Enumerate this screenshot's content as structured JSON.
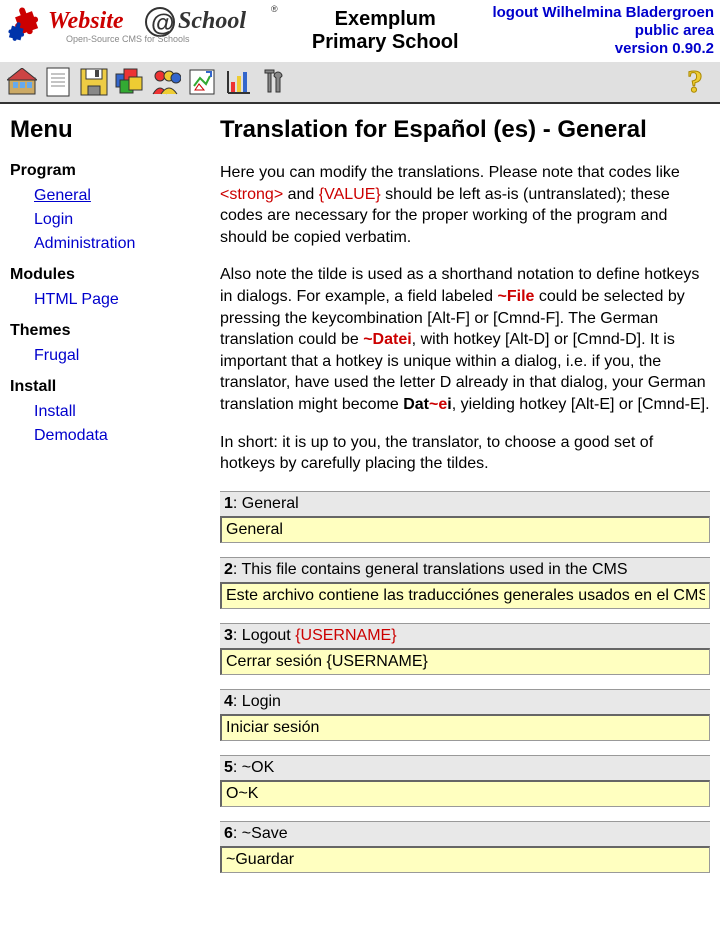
{
  "header": {
    "school_line1": "Exemplum",
    "school_line2": "Primary School",
    "logout_line": "logout Wilhelmina Bladergroen",
    "public_area": "public area",
    "version": "version 0.90.2"
  },
  "sidebar": {
    "title": "Menu",
    "sections": [
      {
        "label": "Program",
        "items": [
          {
            "label": "General",
            "active": true
          },
          {
            "label": "Login"
          },
          {
            "label": "Administration"
          }
        ]
      },
      {
        "label": "Modules",
        "items": [
          {
            "label": "HTML Page"
          }
        ]
      },
      {
        "label": "Themes",
        "items": [
          {
            "label": "Frugal"
          }
        ]
      },
      {
        "label": "Install",
        "items": [
          {
            "label": "Install"
          },
          {
            "label": "Demodata"
          }
        ]
      }
    ]
  },
  "content": {
    "title": "Translation for Español (es) - General",
    "intro_p1_a": "Here you can modify the translations. Please note that codes like ",
    "intro_code1": "<strong>",
    "intro_p1_b": " and ",
    "intro_code2": "{VALUE}",
    "intro_p1_c": " should be left as-is (untranslated); these codes are necessary for the proper working of the program and should be copied verbatim.",
    "intro_p2_a": "Also note the tilde is used as a shorthand notation to define hotkeys in dialogs. For example, a field labeled ",
    "intro_tilde1": "~File",
    "intro_p2_b": " could be selected by pressing the keycombination [Alt-F] or [Cmnd-F]. The German translation could be ",
    "intro_tilde2": "~Datei",
    "intro_p2_c": ", with hotkey [Alt-D] or [Cmnd-D]. It is important that a hotkey is unique within a dialog, i.e. if you, the translator, have used the letter D already in that dialog, your German translation might become ",
    "intro_dat": "Dat",
    "intro_tilde3": "~e",
    "intro_i": "i",
    "intro_p2_d": ", yielding hotkey [Alt-E] or [Cmnd-E].",
    "intro_p3": "In short: it is up to you, the translator, to choose a good set of hotkeys by carefully placing the tildes.",
    "fields": [
      {
        "num": "1",
        "label_plain": "General",
        "value": "General"
      },
      {
        "num": "2",
        "label_plain": "This file contains general translations used in the CMS",
        "value": "Este archivo contiene las traducciónes generales usados en el CMS"
      },
      {
        "num": "3",
        "label_a": "Logout ",
        "label_red": "{USERNAME}",
        "value": "Cerrar sesión {USERNAME}"
      },
      {
        "num": "4",
        "label_plain": "Login",
        "value": "Iniciar sesión"
      },
      {
        "num": "5",
        "label_plain": "~OK",
        "value": "O~K"
      },
      {
        "num": "6",
        "label_plain": "~Save",
        "value": "~Guardar"
      }
    ]
  }
}
